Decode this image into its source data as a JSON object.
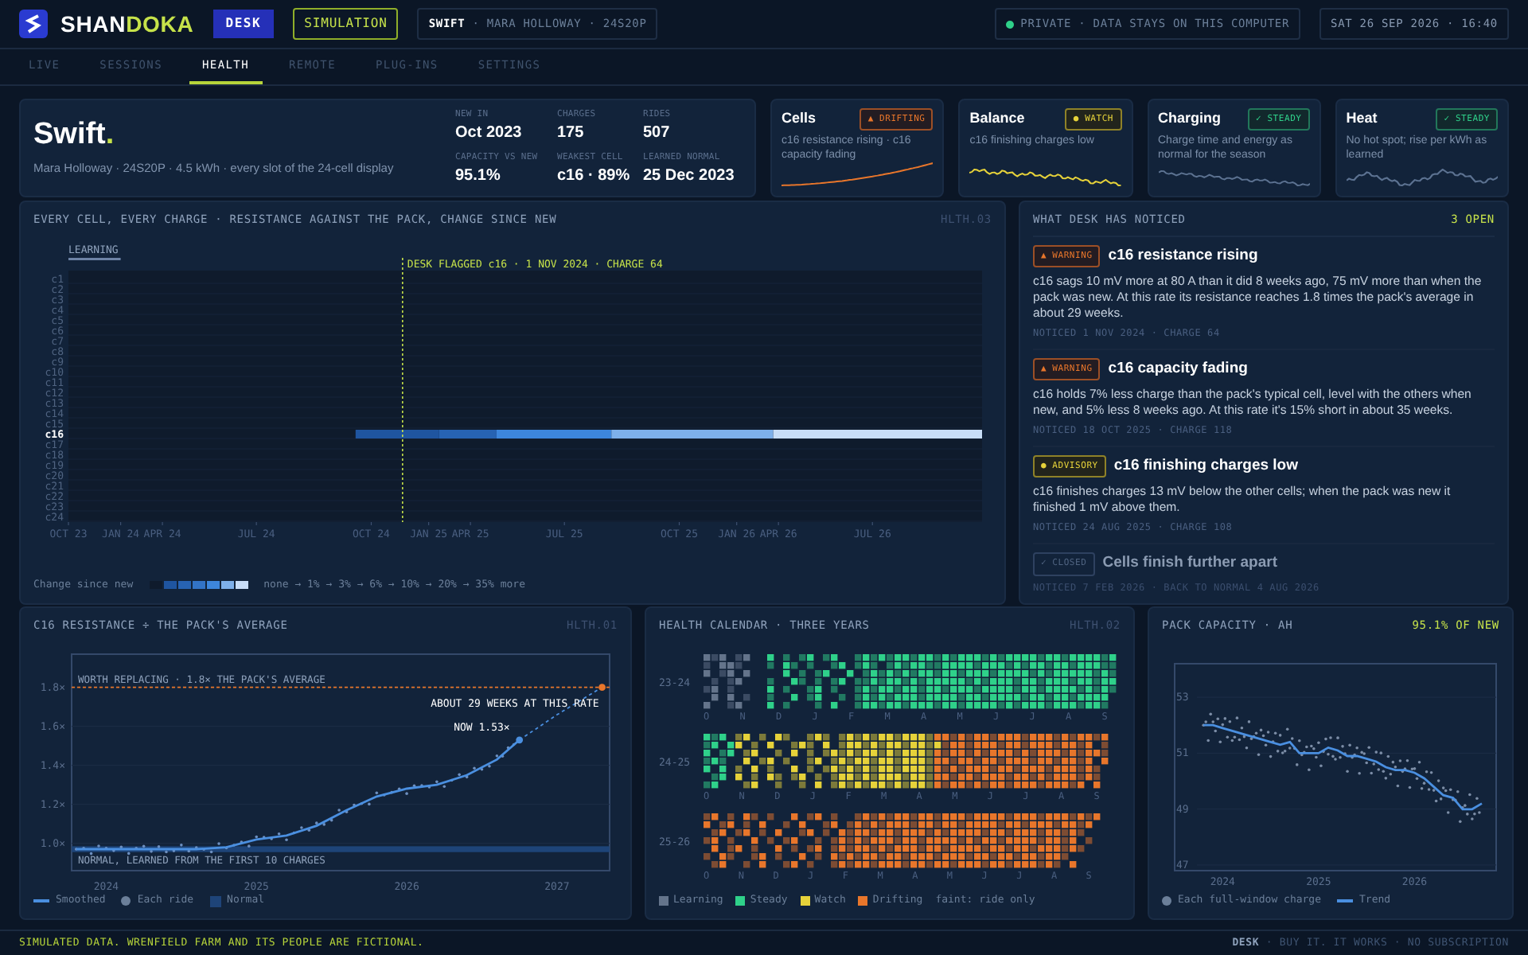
{
  "header": {
    "brand": {
      "name": "SHAN",
      "accent": "DOKA"
    },
    "product_badge": "DESK",
    "mode_badge": "SIMULATION",
    "pack": {
      "name": "SWIFT",
      "detail": "· MARA HOLLOWAY · 24S20P"
    },
    "privacy": "PRIVATE · DATA STAYS ON THIS COMPUTER",
    "datetime": "SAT 26 SEP 2026 · 16:40"
  },
  "tabs": [
    {
      "label": "LIVE",
      "selected": false
    },
    {
      "label": "SESSIONS",
      "selected": false
    },
    {
      "label": "HEALTH",
      "selected": true
    },
    {
      "label": "REMOTE",
      "selected": false
    },
    {
      "label": "PLUG-INS",
      "selected": false
    },
    {
      "label": "SETTINGS",
      "selected": false
    }
  ],
  "summary": {
    "title": "Swift",
    "title_mark": ".",
    "subtitle": "Mara Holloway · 24S20P · 4.5 kWh · every slot of the 24-cell display",
    "stats": [
      {
        "label": "NEW IN",
        "value": "Oct 2023"
      },
      {
        "label": "CHARGES",
        "value": "175"
      },
      {
        "label": "RIDES",
        "value": "507"
      },
      {
        "label": "CAPACITY VS NEW",
        "value": "95.1%"
      },
      {
        "label": "WEAKEST CELL",
        "value": "c16 · 89%"
      },
      {
        "label": "LEARNED NORMAL",
        "value": "25 Dec 2023"
      }
    ]
  },
  "status_cards": [
    {
      "title": "Cells",
      "kind": "drifting",
      "badge": "▲ DRIFTING",
      "text": "c16 resistance rising · c16 capacity fading"
    },
    {
      "title": "Balance",
      "kind": "watch",
      "badge": "● WATCH",
      "text": "c16 finishing charges low"
    },
    {
      "title": "Charging",
      "kind": "steady",
      "badge": "✓ STEADY",
      "text": "Charge time and energy as normal for the season"
    },
    {
      "title": "Heat",
      "kind": "steady",
      "badge": "✓ STEADY",
      "text": "No hot spot; rise per kWh as learned"
    }
  ],
  "cell_map": {
    "title": "EVERY CELL, EVERY CHARGE · RESISTANCE AGAINST THE PACK, CHANGE SINCE NEW",
    "code": "HLTH.03",
    "learning": {
      "label": "LEARNING"
    },
    "flag": {
      "label": "DESK FLAGGED c16 · 1 NOV 2024 · CHARGE 64"
    },
    "rows": [
      {
        "label": "c1",
        "selected": false
      },
      {
        "label": "c2",
        "selected": false
      },
      {
        "label": "c3",
        "selected": false
      },
      {
        "label": "c4",
        "selected": false
      },
      {
        "label": "c5",
        "selected": false
      },
      {
        "label": "c6",
        "selected": false
      },
      {
        "label": "c7",
        "selected": false
      },
      {
        "label": "c8",
        "selected": false
      },
      {
        "label": "c9",
        "selected": false
      },
      {
        "label": "c10",
        "selected": false
      },
      {
        "label": "c11",
        "selected": false
      },
      {
        "label": "c12",
        "selected": false
      },
      {
        "label": "c13",
        "selected": false
      },
      {
        "label": "c14",
        "selected": false
      },
      {
        "label": "c15",
        "selected": false
      },
      {
        "label": "c16",
        "selected": true
      },
      {
        "label": "c17",
        "selected": false
      },
      {
        "label": "c18",
        "selected": false
      },
      {
        "label": "c19",
        "selected": false
      },
      {
        "label": "c20",
        "selected": false
      },
      {
        "label": "c21",
        "selected": false
      },
      {
        "label": "c22",
        "selected": false
      },
      {
        "label": "c23",
        "selected": false
      },
      {
        "label": "c24",
        "selected": false
      }
    ],
    "segments": [
      {
        "color": "#1f55a0"
      },
      {
        "color": "#2763b3"
      },
      {
        "color": "#3d86dc"
      },
      {
        "color": "#7eb0ea"
      },
      {
        "color": "#c8ddf7"
      }
    ],
    "x_ticks": [
      {
        "label": "OCT 23"
      },
      {
        "label": "JAN 24"
      },
      {
        "label": "APR 24"
      },
      {
        "label": "JUL 24"
      },
      {
        "label": "OCT 24"
      },
      {
        "label": "JAN 25"
      },
      {
        "label": "APR 25"
      },
      {
        "label": "JUL 25"
      },
      {
        "label": "OCT 25"
      },
      {
        "label": "JAN 26"
      },
      {
        "label": "APR 26"
      },
      {
        "label": "JUL 26"
      }
    ],
    "legend": {
      "label": "Change since new",
      "swatches": [
        {
          "color": "#0f1b2c"
        },
        {
          "color": "#1f55a0"
        },
        {
          "color": "#2763b3"
        },
        {
          "color": "#3273c6"
        },
        {
          "color": "#3d86dc"
        },
        {
          "color": "#7eb0ea"
        },
        {
          "color": "#c8ddf7"
        }
      ],
      "scale": "none → 1% → 3% → 6% → 10% → 20% → 35% more"
    }
  },
  "notices": {
    "title": "WHAT DESK HAS NOTICED",
    "count": "3 OPEN",
    "items": [
      {
        "kind": "warning",
        "tag": "▲ WARNING",
        "title": "c16 resistance rising",
        "body": "c16 sags 10 mV more at 80 A than it did 8 weeks ago, 75 mV more than when the pack was new. At this rate its resistance reaches 1.8 times the pack's average in about 29 weeks.",
        "meta": "NOTICED 1 NOV 2024 · CHARGE 64"
      },
      {
        "kind": "warning",
        "tag": "▲ WARNING",
        "title": "c16 capacity fading",
        "body": "c16 holds 7% less charge than the pack's typical cell, level with the others when new, and 5% less 8 weeks ago. At this rate it's 15% short in about 35 weeks.",
        "meta": "NOTICED 18 OCT 2025 · CHARGE 118"
      },
      {
        "kind": "advisory",
        "tag": "● ADVISORY",
        "title": "c16 finishing charges low",
        "body": "c16 finishes charges 13 mV below the other cells; when the pack was new it finished 1 mV above them.",
        "meta": "NOTICED 24 AUG 2025 · CHARGE 108"
      },
      {
        "kind": "closed",
        "tag": "✓ CLOSED",
        "title": "Cells finish further apart",
        "meta": "NOTICED 7 FEB 2026 · BACK TO NORMAL 4 AUG 2026"
      }
    ]
  },
  "resistance": {
    "title": "C16 RESISTANCE ÷ THE PACK'S AVERAGE",
    "code": "HLTH.01",
    "chart_data": {
      "type": "line",
      "x": [
        2023.8,
        2024.0,
        2024.2,
        2024.4,
        2024.6,
        2024.8,
        2025.0,
        2025.2,
        2025.4,
        2025.6,
        2025.8,
        2026.0,
        2026.2,
        2026.4,
        2026.6,
        2026.75,
        2027.0,
        2027.3
      ],
      "series": [
        {
          "name": "Smoothed",
          "color": "#4a8fe0",
          "values": [
            0.97,
            0.97,
            0.97,
            0.97,
            0.97,
            0.98,
            1.02,
            1.04,
            1.09,
            1.17,
            1.24,
            1.28,
            1.3,
            1.35,
            1.43,
            1.53,
            null,
            null
          ]
        },
        {
          "color": "#4a8fe0",
          "line_style": "dashed",
          "values": [
            null,
            null,
            null,
            null,
            null,
            null,
            null,
            null,
            null,
            null,
            null,
            null,
            null,
            null,
            null,
            1.53,
            1.66,
            1.8
          ]
        }
      ],
      "grid": true,
      "xlim": [
        2023.77,
        2027.35
      ],
      "ylim": [
        0.86,
        1.97
      ],
      "xticks": [
        {
          "value": 2024,
          "label": "2024"
        },
        {
          "value": 2025,
          "label": "2025"
        },
        {
          "value": 2026,
          "label": "2026"
        },
        {
          "value": 2027,
          "label": "2027"
        }
      ],
      "yticks": [
        {
          "value": 1.0,
          "label": "1.0×"
        },
        {
          "value": 1.2,
          "label": "1.2×"
        },
        {
          "value": 1.4,
          "label": "1.4×"
        },
        {
          "value": 1.6,
          "label": "1.6×"
        },
        {
          "value": 1.8,
          "label": "1.8×"
        }
      ],
      "ref_lines": [
        {
          "axis": "y",
          "value": 1.8,
          "label": "WORTH REPLACING · 1.8× THE PACK'S AVERAGE",
          "color": "#e8762b"
        }
      ],
      "bands": [
        {
          "axis": "y",
          "from": 0.955,
          "to": 0.985,
          "label": "NORMAL, LEARNED FROM THE FIRST 10 CHARGES",
          "color": "#1e4478"
        }
      ],
      "annotations": [
        {
          "text": "ABOUT 29 WEEKS AT THIS RATE",
          "x": 2027.3,
          "y": 1.8
        },
        {
          "text": "NOW 1.53×",
          "x": 2026.75,
          "y": 1.53
        }
      ]
    },
    "legend": [
      {
        "kind": "line"
      },
      {
        "label": "Each ride",
        "kind": "dot"
      },
      {
        "label": "Normal",
        "kind": "band"
      }
    ]
  },
  "calendar": {
    "title": "HEALTH CALENDAR · THREE YEARS",
    "code": "HLTH.02",
    "years": [
      {
        "label": "23-24",
        "months": [
          "O",
          "N",
          "D",
          "J",
          "F",
          "M",
          "A",
          "M",
          "J",
          "J",
          "A",
          "S"
        ]
      },
      {
        "label": "24-25",
        "months": [
          "O",
          "N",
          "D",
          "J",
          "F",
          "M",
          "A",
          "M",
          "J",
          "J",
          "A",
          "S"
        ]
      },
      {
        "label": "25-26",
        "months": [
          "O",
          "N",
          "D",
          "J",
          "F",
          "M",
          "A",
          "M",
          "J",
          "J",
          "A",
          "S"
        ]
      }
    ],
    "legend": [
      {
        "label": "Learning",
        "color": "#64748b"
      },
      {
        "label": "Steady",
        "color": "#2fd18a"
      },
      {
        "label": "Watch",
        "color": "#e6d23a"
      },
      {
        "label": "Drifting",
        "color": "#e8762b"
      }
    ],
    "note": "faint: ride only"
  },
  "capacity": {
    "title": "PACK CAPACITY · AH",
    "headline": "95.1% OF NEW",
    "chart_data": {
      "type": "line",
      "x": [
        2023.8,
        2023.9,
        2024.0,
        2024.1,
        2024.2,
        2024.3,
        2024.4,
        2024.5,
        2024.6,
        2024.7,
        2024.8,
        2024.9,
        2025.0,
        2025.1,
        2025.2,
        2025.3,
        2025.4,
        2025.5,
        2025.6,
        2025.7,
        2025.8,
        2025.9,
        2026.0,
        2026.1,
        2026.2,
        2026.3,
        2026.4,
        2026.5,
        2026.6,
        2026.7
      ],
      "series": [
        {
          "name": "Trend",
          "color": "#4a8fe0",
          "values": [
            52.0,
            52.0,
            51.9,
            51.8,
            51.7,
            51.6,
            51.5,
            51.4,
            51.3,
            51.4,
            51.0,
            51.0,
            51.0,
            51.2,
            51.1,
            50.9,
            50.9,
            50.8,
            50.7,
            50.5,
            50.4,
            50.4,
            50.3,
            50.1,
            49.8,
            49.5,
            49.4,
            49.0,
            49.0,
            49.2
          ]
        }
      ],
      "grid": true,
      "xlim": [
        2023.5,
        2026.85
      ],
      "ylim": [
        46.8,
        54.2
      ],
      "xticks": [
        {
          "value": 2024,
          "label": "2024"
        },
        {
          "value": 2025,
          "label": "2025"
        },
        {
          "value": 2026,
          "label": "2026"
        }
      ],
      "yticks": [
        {
          "value": 47,
          "label": "47"
        },
        {
          "value": 49,
          "label": "49"
        },
        {
          "value": 51,
          "label": "51"
        },
        {
          "value": 53,
          "label": "53"
        }
      ]
    },
    "legend": [
      {
        "label": "Each full-window charge",
        "kind": "dot"
      },
      {
        "kind": "line"
      }
    ]
  },
  "footer": {
    "notice": "SIMULATED DATA. WRENFIELD FARM AND ITS PEOPLE ARE FICTIONAL.",
    "brand": "DESK",
    "tagline": "· BUY IT. IT WORKS · NO SUBSCRIPTION"
  }
}
